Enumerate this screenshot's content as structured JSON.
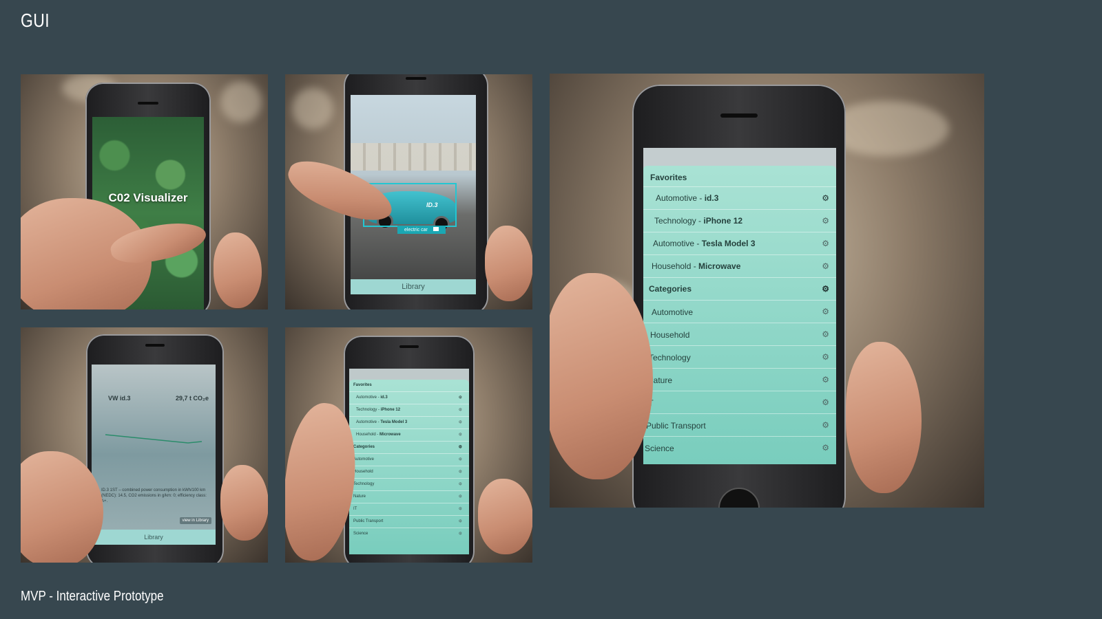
{
  "slide": {
    "title": "GUI",
    "footer": "MVP - Interactive Prototype"
  },
  "splash": {
    "title": "C02 Visualizer"
  },
  "ar_screen": {
    "car_badge": "ID.3",
    "tag": "electric car",
    "nav": "Library"
  },
  "detail_screen": {
    "model": "VW id.3",
    "emissions": "29,7 t CO₂e",
    "description": "ID.3 1ST – combined power consumption in kWh/100 km (NEDC): 14.5, CO2 emissions in g/km: 0; efficiency class: A+.",
    "view_button": "view in Library",
    "nav": "Library"
  },
  "menu": {
    "favorites_header": "Favorites",
    "favorites": [
      {
        "prefix": "Automotive - ",
        "item": "id.3"
      },
      {
        "prefix": "Technology - ",
        "item": "iPhone 12"
      },
      {
        "prefix": "Automotive - ",
        "item": "Tesla Model 3"
      },
      {
        "prefix": "Household - ",
        "item": "Microwave"
      }
    ],
    "categories_header": "Categories",
    "categories": [
      "Automotive",
      "Household",
      "Technology",
      "Nature",
      "IT",
      "Public Transport",
      "Science"
    ]
  },
  "icons": {
    "gear": "gear-icon",
    "camera": "camera-icon"
  },
  "colors": {
    "background": "#37474f",
    "menu": "#8fd6c6",
    "accent": "#1ba7b3"
  }
}
